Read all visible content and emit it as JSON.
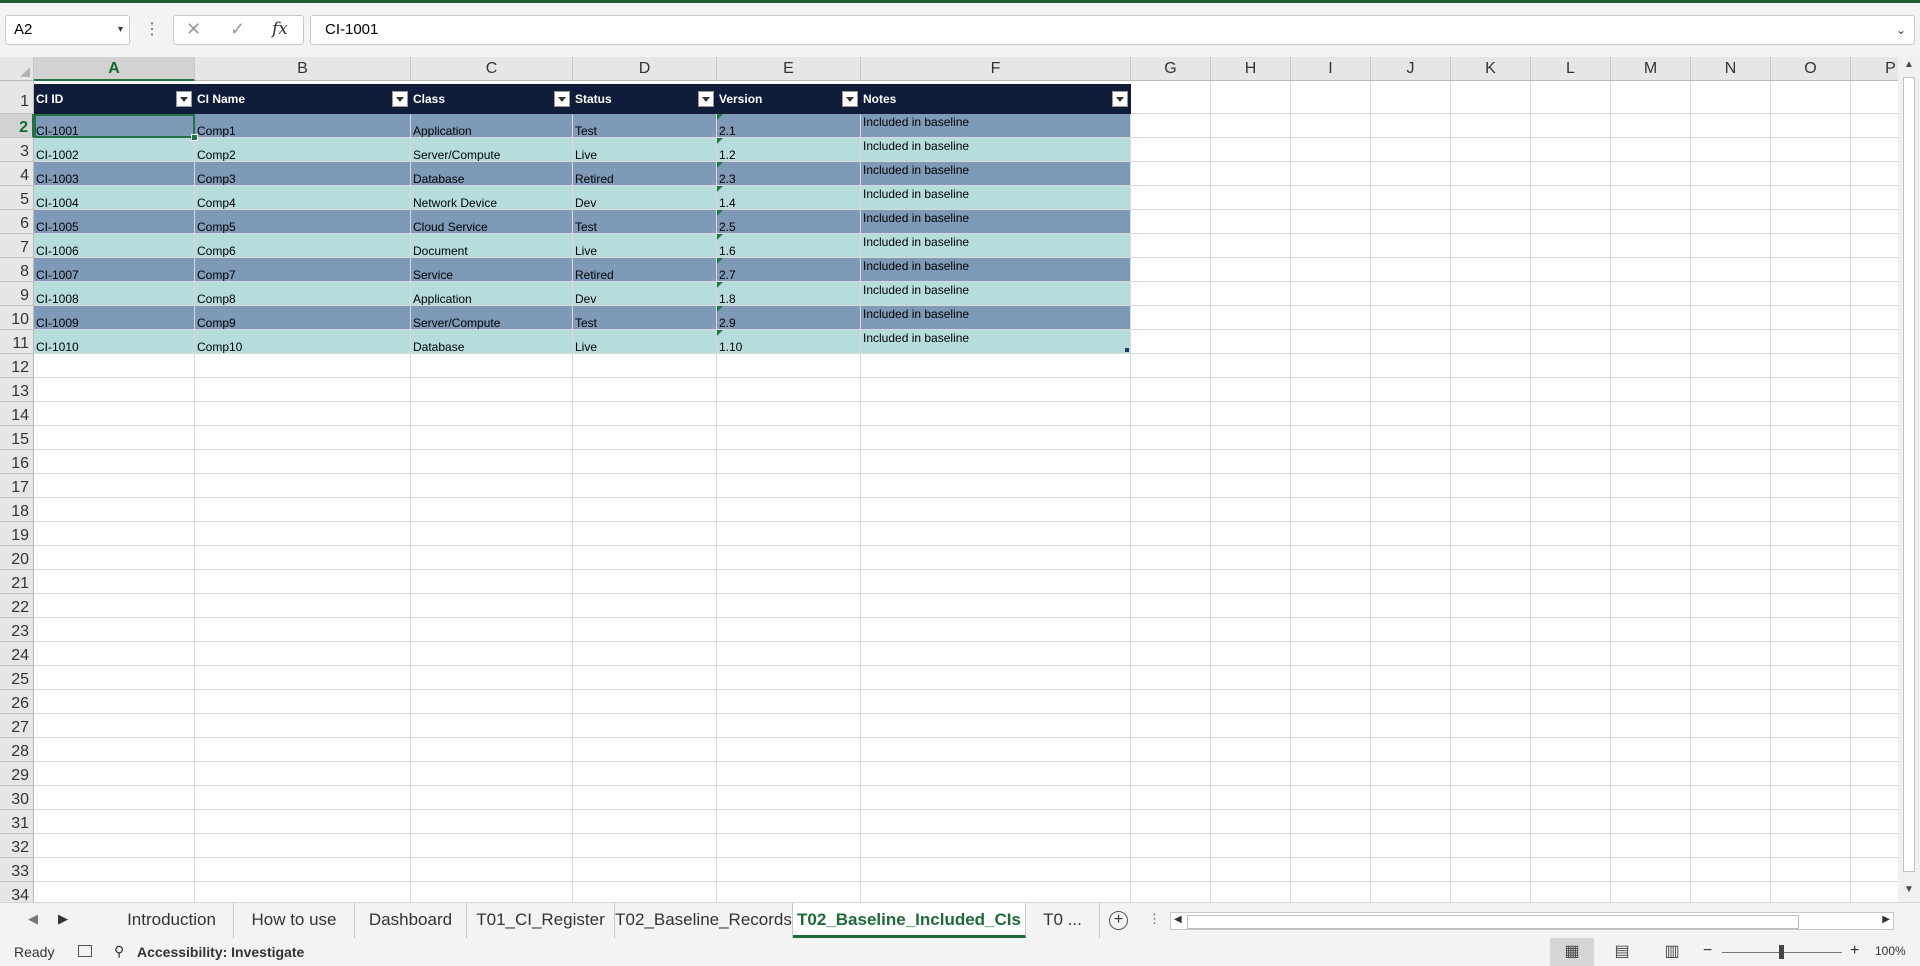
{
  "formula_bar": {
    "name_box": "A2",
    "cancel_icon": "✕",
    "enter_icon": "✓",
    "fx_label": "fx",
    "formula": "CI-1001"
  },
  "columns": [
    "A",
    "B",
    "C",
    "D",
    "E",
    "F",
    "G",
    "H",
    "I",
    "J",
    "K",
    "L",
    "M",
    "N",
    "O",
    "P"
  ],
  "selected_column": "A",
  "row_numbers": [
    "1",
    "2",
    "3",
    "4",
    "5",
    "6",
    "7",
    "8",
    "9",
    "10",
    "11",
    "12",
    "13",
    "14",
    "15",
    "16",
    "17",
    "18",
    "19",
    "20",
    "21",
    "22",
    "23",
    "24",
    "25",
    "26",
    "27",
    "28",
    "29",
    "30",
    "31",
    "32",
    "33",
    "34"
  ],
  "selected_row": "2",
  "table": {
    "headers": [
      "CI ID",
      "CI Name",
      "Class",
      "Status",
      "Version",
      "Notes"
    ],
    "rows": [
      [
        "CI-1001",
        "Comp1",
        "Application",
        "Test",
        "2.1",
        "Included in baseline"
      ],
      [
        "CI-1002",
        "Comp2",
        "Server/Compute",
        "Live",
        "1.2",
        "Included in baseline"
      ],
      [
        "CI-1003",
        "Comp3",
        "Database",
        "Retired",
        "2.3",
        "Included in baseline"
      ],
      [
        "CI-1004",
        "Comp4",
        "Network Device",
        "Dev",
        "1.4",
        "Included in baseline"
      ],
      [
        "CI-1005",
        "Comp5",
        "Cloud Service",
        "Test",
        "2.5",
        "Included in baseline"
      ],
      [
        "CI-1006",
        "Comp6",
        "Document",
        "Live",
        "1.6",
        "Included in baseline"
      ],
      [
        "CI-1007",
        "Comp7",
        "Service",
        "Retired",
        "2.7",
        "Included in baseline"
      ],
      [
        "CI-1008",
        "Comp8",
        "Application",
        "Dev",
        "1.8",
        "Included in baseline"
      ],
      [
        "CI-1009",
        "Comp9",
        "Server/Compute",
        "Test",
        "2.9",
        "Included in baseline"
      ],
      [
        "CI-1010",
        "Comp10",
        "Database",
        "Live",
        "1.10",
        "Included in baseline"
      ]
    ]
  },
  "sheet_tabs": [
    {
      "label": "Introduction",
      "selected": false
    },
    {
      "label": "How to use",
      "selected": false
    },
    {
      "label": "Dashboard",
      "selected": false
    },
    {
      "label": "T01_CI_Register",
      "selected": false
    },
    {
      "label": "T02_Baseline_Records",
      "selected": false
    },
    {
      "label": "T02_Baseline_Included_CIs",
      "selected": true
    },
    {
      "label": "T0 ...",
      "selected": false
    }
  ],
  "status_bar": {
    "mode": "Ready",
    "accessibility": "Accessibility: Investigate",
    "zoom": "100%"
  },
  "colors": {
    "header_fill": "#0f1d3a",
    "band_dark": "#7e9ab7",
    "band_light": "#b6dcdc",
    "accent": "#217346"
  }
}
